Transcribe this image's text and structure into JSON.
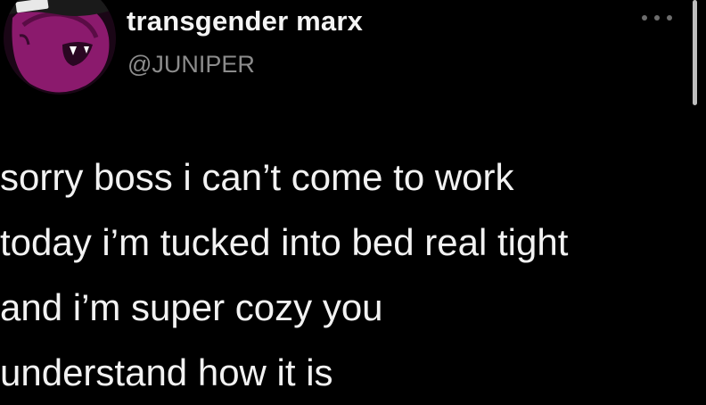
{
  "tweet": {
    "display_name": "transgender marx",
    "handle": "@JUNIPER",
    "avatar_icon": "purple-cartoon-face-avatar",
    "more_icon": "more-options-icon",
    "body_lines": [
      "sorry boss i can’t come to work",
      "today i’m tucked into bed real tight",
      "and i’m super cozy you",
      "understand how it is"
    ]
  },
  "colors": {
    "background": "#000000",
    "name": "#f4f4f4",
    "handle": "#8c8c8c",
    "avatar_purple": "#8b1a6d"
  }
}
